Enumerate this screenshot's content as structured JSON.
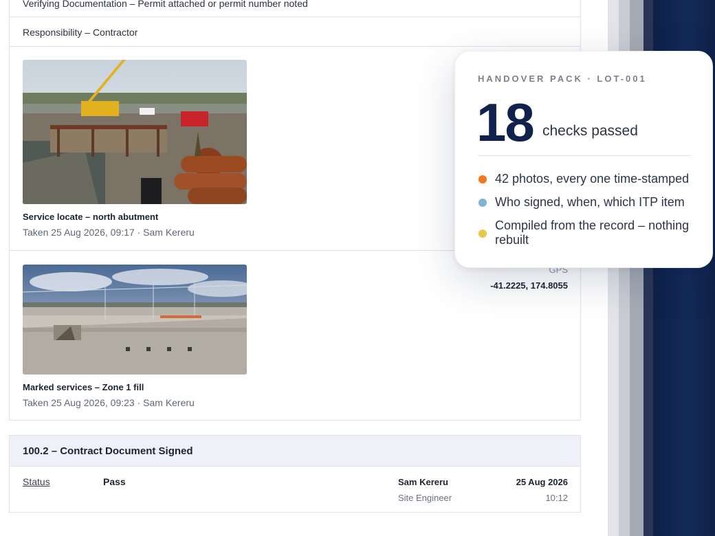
{
  "document": {
    "verifying_line": "Verifying Documentation – Permit attached or permit number noted",
    "responsibility_line": "Responsibility – Contractor",
    "gps_label": "GPS",
    "gps_value": "-41.2225, 174.8055",
    "photos": [
      {
        "caption": "Service locate – north abutment",
        "meta": "Taken 25 Aug 2026, 09:17 · Sam Kereru"
      },
      {
        "caption": "Marked services – Zone 1 fill",
        "meta": "Taken 25 Aug 2026, 09:23 · Sam Kereru"
      }
    ]
  },
  "section": {
    "title": "100.2 – Contract Document Signed",
    "status_label": "Status",
    "status_value": "Pass",
    "signer_name": "Sam Kereru",
    "signer_role": "Site Engineer",
    "date": "25 Aug 2026",
    "time": "10:12"
  },
  "summary": {
    "kicker": "HANDOVER PACK · LOT-001",
    "count": "18",
    "count_label": "checks passed",
    "bullets": [
      {
        "text": "42 photos, every one time-stamped",
        "color": "#f2781f"
      },
      {
        "text": "Who signed, when, which ITP item",
        "color": "#7fb3d6"
      },
      {
        "text": "Compiled from the record – nothing rebuilt",
        "color": "#e6c94a"
      }
    ]
  }
}
